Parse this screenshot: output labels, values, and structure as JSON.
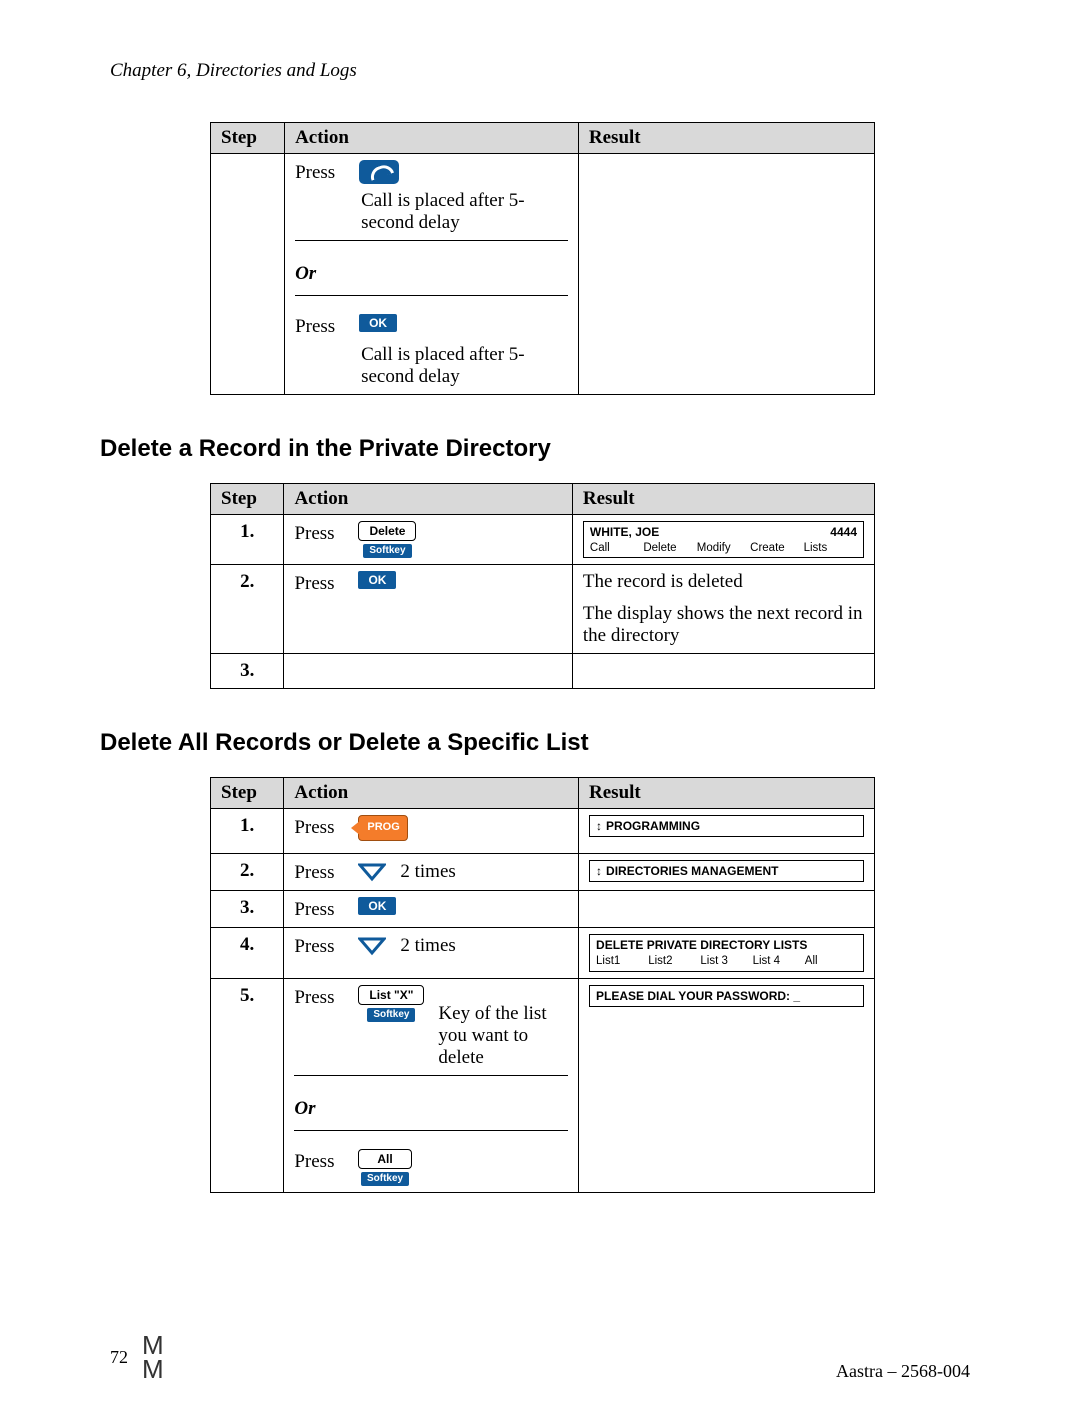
{
  "chapter": "Chapter 6, Directories and Logs",
  "columns": {
    "step": "Step",
    "action": "Action",
    "result": "Result"
  },
  "common": {
    "press": "Press",
    "or": "Or",
    "ok": "OK",
    "softkey": "Softkey",
    "prog": "PROG",
    "delete": "Delete",
    "all": "All",
    "listx": "List \"X\""
  },
  "callTable": {
    "callDelay": "Call is placed after 5-second delay"
  },
  "section1": {
    "title": "Delete a Record in the Private Directory",
    "step1Result": {
      "name": "WHITE, JOE",
      "number": "4444",
      "opts": [
        "Call",
        "Delete",
        "Modify",
        "Create",
        "Lists"
      ]
    },
    "step2Result1": "The record is deleted",
    "step2Result2": "The display shows the next record in the directory"
  },
  "section2": {
    "title": "Delete All Records or Delete a Specific List",
    "twoTimes": "2 times",
    "r1": "PROGRAMMING",
    "r2": "DIRECTORIES MANAGEMENT",
    "r4title": "DELETE PRIVATE DIRECTORY LISTS",
    "r4opts": [
      "List1",
      "List2",
      "List 3",
      "List 4",
      "All"
    ],
    "r5": "PLEASE DIAL YOUR PASSWORD: _",
    "keyOfList": "Key of the list you want to delete"
  },
  "footer": {
    "pageNum": "72",
    "logo": "M\nM",
    "docRef": "Aastra – 2568-004"
  }
}
